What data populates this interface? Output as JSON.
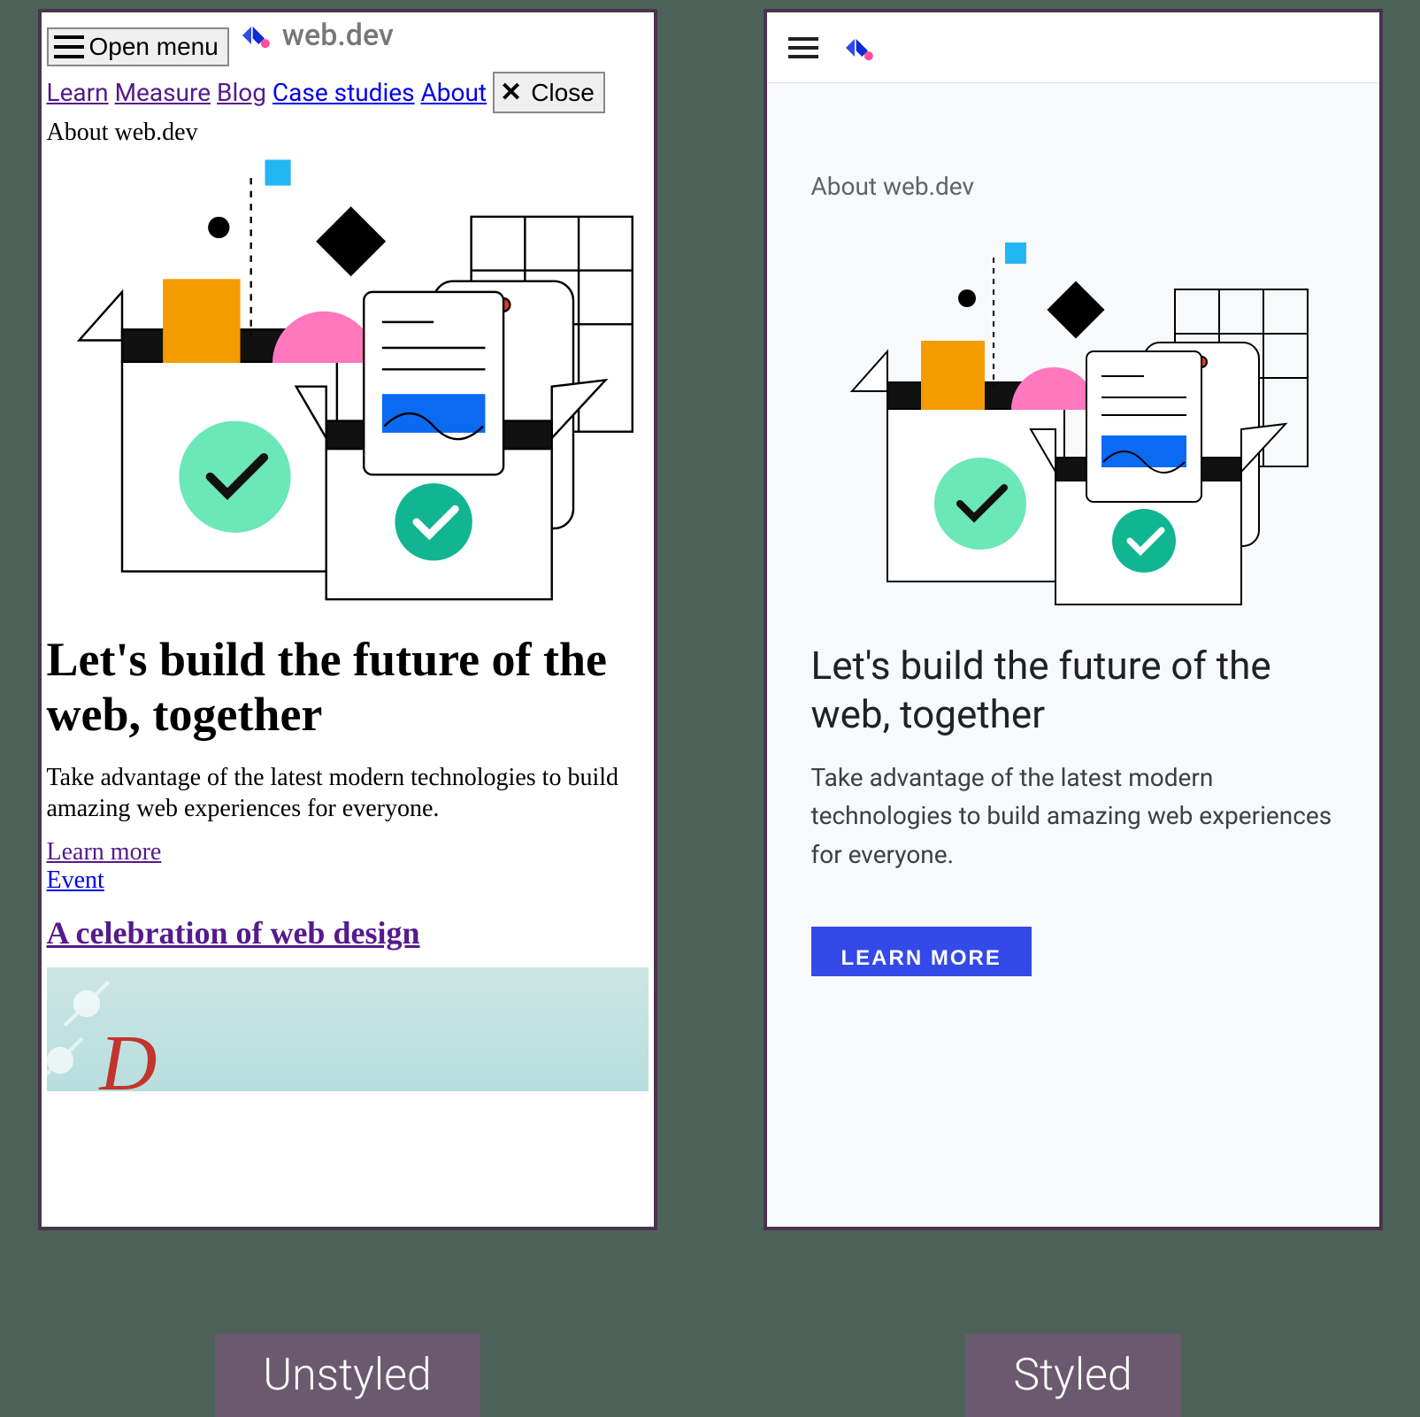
{
  "captions": {
    "left": "Unstyled",
    "right": "Styled"
  },
  "unstyled": {
    "open_menu": "Open menu",
    "logo_text": "web.dev",
    "nav": {
      "learn": "Learn",
      "measure": "Measure",
      "blog": "Blog",
      "case_studies": "Case studies",
      "about": "About"
    },
    "close": "Close",
    "breadcrumb": "About web.dev",
    "heading": "Let's build the future of the web, together",
    "subtext": "Take advantage of the latest modern technologies to build amazing web experiences for everyone.",
    "learn_more": "Learn more",
    "event": "Event",
    "celebration_heading": "A celebration of web design"
  },
  "styled": {
    "breadcrumb": "About web.dev",
    "heading": "Let's build the future of the web, together",
    "subtext": "Take advantage of the latest modern technologies to build amazing web experiences for everyone.",
    "cta": "LEARN MORE"
  }
}
